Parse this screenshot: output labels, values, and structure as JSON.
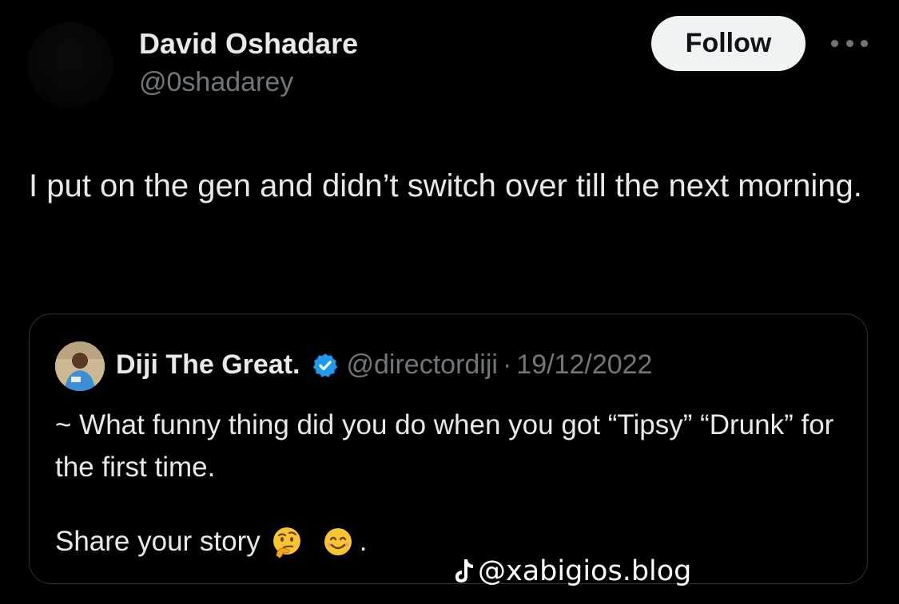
{
  "tweet": {
    "author_name": "David Oshadare",
    "author_handle": "@0shadarey",
    "follow_label": "Follow",
    "more_icon": "more-horizontal-icon",
    "text": "I put on the gen and didn’t switch over till the next morning."
  },
  "quote": {
    "author_name": "Diji The Great.",
    "verified_icon": "verified-badge-icon",
    "author_handle": "@directordiji",
    "separator": "·",
    "date": "19/12/2022",
    "text": "~ What funny thing did you do when you got “Tipsy” “Drunk” for the first time.",
    "share_text": "Share your story",
    "emojis": [
      "thinking-face-emoji",
      "smiling-face-emoji"
    ],
    "share_end": "."
  },
  "watermark": {
    "icon": "tiktok-icon",
    "text": "@xabigios.blog"
  },
  "colors": {
    "background": "#000000",
    "primary_text": "#e7e9ea",
    "secondary_text": "#71767b",
    "border": "#2f3336",
    "verified": "#1d9bf0",
    "follow_bg": "#eff3f4"
  }
}
